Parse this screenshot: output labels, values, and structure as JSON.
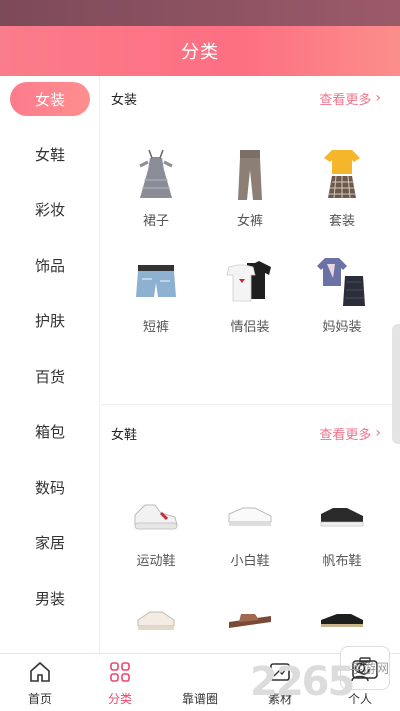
{
  "header": {
    "title": "分类"
  },
  "sidebar": {
    "items": [
      {
        "label": "女装",
        "active": true
      },
      {
        "label": "女鞋"
      },
      {
        "label": "彩妆"
      },
      {
        "label": "饰品"
      },
      {
        "label": "护肤"
      },
      {
        "label": "百货"
      },
      {
        "label": "箱包"
      },
      {
        "label": "数码"
      },
      {
        "label": "家居"
      },
      {
        "label": "男装"
      }
    ]
  },
  "sections": [
    {
      "title": "女装",
      "more": "查看更多",
      "items": [
        {
          "label": "裙子",
          "icon": "dress-icon"
        },
        {
          "label": "女裤",
          "icon": "pants-icon"
        },
        {
          "label": "套装",
          "icon": "outfit-set-icon"
        },
        {
          "label": "短裤",
          "icon": "shorts-icon"
        },
        {
          "label": "情侣装",
          "icon": "couple-tshirt-icon"
        },
        {
          "label": "妈妈装",
          "icon": "mom-outfit-icon"
        }
      ]
    },
    {
      "title": "女鞋",
      "more": "查看更多",
      "items": [
        {
          "label": "运动鞋",
          "icon": "sneaker-icon"
        },
        {
          "label": "小白鞋",
          "icon": "white-shoe-icon"
        },
        {
          "label": "帆布鞋",
          "icon": "canvas-shoe-icon"
        },
        {
          "label": "",
          "icon": "shoe-icon"
        },
        {
          "label": "",
          "icon": "sandal-icon"
        },
        {
          "label": "",
          "icon": "loafer-icon"
        }
      ]
    }
  ],
  "tabbar": {
    "items": [
      {
        "label": "首页",
        "icon": "home-icon"
      },
      {
        "label": "分类",
        "icon": "category-grid-icon",
        "active": true
      },
      {
        "label": "靠谱圈",
        "icon": "camera-icon"
      },
      {
        "label": "素材",
        "icon": "material-icon"
      },
      {
        "label": "个人",
        "icon": "user-icon"
      }
    ]
  },
  "watermark": {
    "number": "2265",
    "suffix": ".com",
    "site": "手游网"
  },
  "colors": {
    "accent": "#fd7b8b",
    "active_tab": "#f0476b",
    "more_link": "#f37289"
  }
}
